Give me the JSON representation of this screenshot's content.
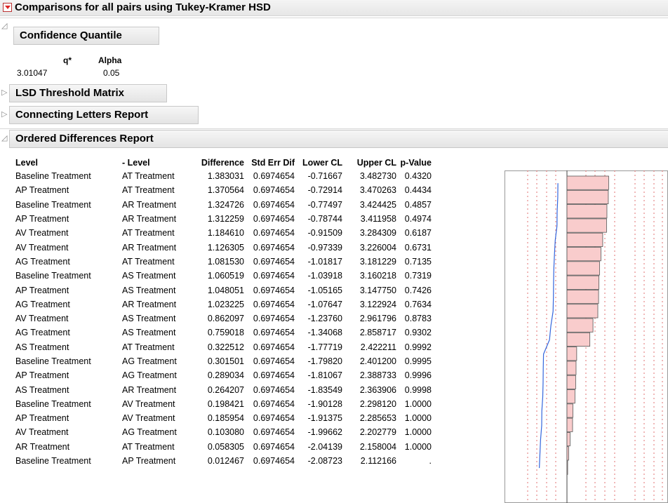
{
  "title": "Comparisons for all pairs using Tukey-Kramer HSD",
  "sections": {
    "confidence_quantile": {
      "label": "Confidence Quantile",
      "q_header": "q*",
      "alpha_header": "Alpha",
      "q_value": "3.01047",
      "alpha_value": "0.05"
    },
    "lsd": {
      "label": "LSD Threshold Matrix"
    },
    "connecting": {
      "label": "Connecting Letters Report"
    },
    "ordered": {
      "label": "Ordered Differences Report"
    }
  },
  "ordered_table": {
    "headers": {
      "level": "Level",
      "level2": "- Level",
      "difference": "Difference",
      "stderr": "Std Err Dif",
      "lower": "Lower CL",
      "upper": "Upper CL",
      "pvalue": "p-Value"
    },
    "rows": [
      {
        "level": "Baseline Treatment",
        "level2": "AT Treatment",
        "difference": "1.383031",
        "stderr": "0.6974654",
        "lower": "-0.71667",
        "upper": "3.482730",
        "pvalue": "0.4320"
      },
      {
        "level": "AP Treatment",
        "level2": "AT Treatment",
        "difference": "1.370564",
        "stderr": "0.6974654",
        "lower": "-0.72914",
        "upper": "3.470263",
        "pvalue": "0.4434"
      },
      {
        "level": "Baseline Treatment",
        "level2": "AR Treatment",
        "difference": "1.324726",
        "stderr": "0.6974654",
        "lower": "-0.77497",
        "upper": "3.424425",
        "pvalue": "0.4857"
      },
      {
        "level": "AP Treatment",
        "level2": "AR Treatment",
        "difference": "1.312259",
        "stderr": "0.6974654",
        "lower": "-0.78744",
        "upper": "3.411958",
        "pvalue": "0.4974"
      },
      {
        "level": "AV Treatment",
        "level2": "AT Treatment",
        "difference": "1.184610",
        "stderr": "0.6974654",
        "lower": "-0.91509",
        "upper": "3.284309",
        "pvalue": "0.6187"
      },
      {
        "level": "AV Treatment",
        "level2": "AR Treatment",
        "difference": "1.126305",
        "stderr": "0.6974654",
        "lower": "-0.97339",
        "upper": "3.226004",
        "pvalue": "0.6731"
      },
      {
        "level": "AG Treatment",
        "level2": "AT Treatment",
        "difference": "1.081530",
        "stderr": "0.6974654",
        "lower": "-1.01817",
        "upper": "3.181229",
        "pvalue": "0.7135"
      },
      {
        "level": "Baseline Treatment",
        "level2": "AS Treatment",
        "difference": "1.060519",
        "stderr": "0.6974654",
        "lower": "-1.03918",
        "upper": "3.160218",
        "pvalue": "0.7319"
      },
      {
        "level": "AP Treatment",
        "level2": "AS Treatment",
        "difference": "1.048051",
        "stderr": "0.6974654",
        "lower": "-1.05165",
        "upper": "3.147750",
        "pvalue": "0.7426"
      },
      {
        "level": "AG Treatment",
        "level2": "AR Treatment",
        "difference": "1.023225",
        "stderr": "0.6974654",
        "lower": "-1.07647",
        "upper": "3.122924",
        "pvalue": "0.7634"
      },
      {
        "level": "AV Treatment",
        "level2": "AS Treatment",
        "difference": "0.862097",
        "stderr": "0.6974654",
        "lower": "-1.23760",
        "upper": "2.961796",
        "pvalue": "0.8783"
      },
      {
        "level": "AG Treatment",
        "level2": "AS Treatment",
        "difference": "0.759018",
        "stderr": "0.6974654",
        "lower": "-1.34068",
        "upper": "2.858717",
        "pvalue": "0.9302"
      },
      {
        "level": "AS Treatment",
        "level2": "AT Treatment",
        "difference": "0.322512",
        "stderr": "0.6974654",
        "lower": "-1.77719",
        "upper": "2.422211",
        "pvalue": "0.9992"
      },
      {
        "level": "Baseline Treatment",
        "level2": "AG Treatment",
        "difference": "0.301501",
        "stderr": "0.6974654",
        "lower": "-1.79820",
        "upper": "2.401200",
        "pvalue": "0.9995"
      },
      {
        "level": "AP Treatment",
        "level2": "AG Treatment",
        "difference": "0.289034",
        "stderr": "0.6974654",
        "lower": "-1.81067",
        "upper": "2.388733",
        "pvalue": "0.9996"
      },
      {
        "level": "AS Treatment",
        "level2": "AR Treatment",
        "difference": "0.264207",
        "stderr": "0.6974654",
        "lower": "-1.83549",
        "upper": "2.363906",
        "pvalue": "0.9998"
      },
      {
        "level": "Baseline Treatment",
        "level2": "AV Treatment",
        "difference": "0.198421",
        "stderr": "0.6974654",
        "lower": "-1.90128",
        "upper": "2.298120",
        "pvalue": "1.0000"
      },
      {
        "level": "AP Treatment",
        "level2": "AV Treatment",
        "difference": "0.185954",
        "stderr": "0.6974654",
        "lower": "-1.91375",
        "upper": "2.285653",
        "pvalue": "1.0000"
      },
      {
        "level": "AV Treatment",
        "level2": "AG Treatment",
        "difference": "0.103080",
        "stderr": "0.6974654",
        "lower": "-1.99662",
        "upper": "2.202779",
        "pvalue": "1.0000"
      },
      {
        "level": "AR Treatment",
        "level2": "AT Treatment",
        "difference": "0.058305",
        "stderr": "0.6974654",
        "lower": "-2.04139",
        "upper": "2.158004",
        "pvalue": "1.0000"
      },
      {
        "level": "Baseline Treatment",
        "level2": "AP Treatment",
        "difference": "0.012467",
        "stderr": "0.6974654",
        "lower": "-2.08723",
        "upper": "2.112166",
        "pvalue": "."
      }
    ]
  },
  "colors": {
    "bar_fill": "#f9cccc",
    "bar_stroke": "#555555",
    "ci_line": "#3366dd",
    "ref_line": "#e07070",
    "red_triangle": "#dd2222"
  }
}
